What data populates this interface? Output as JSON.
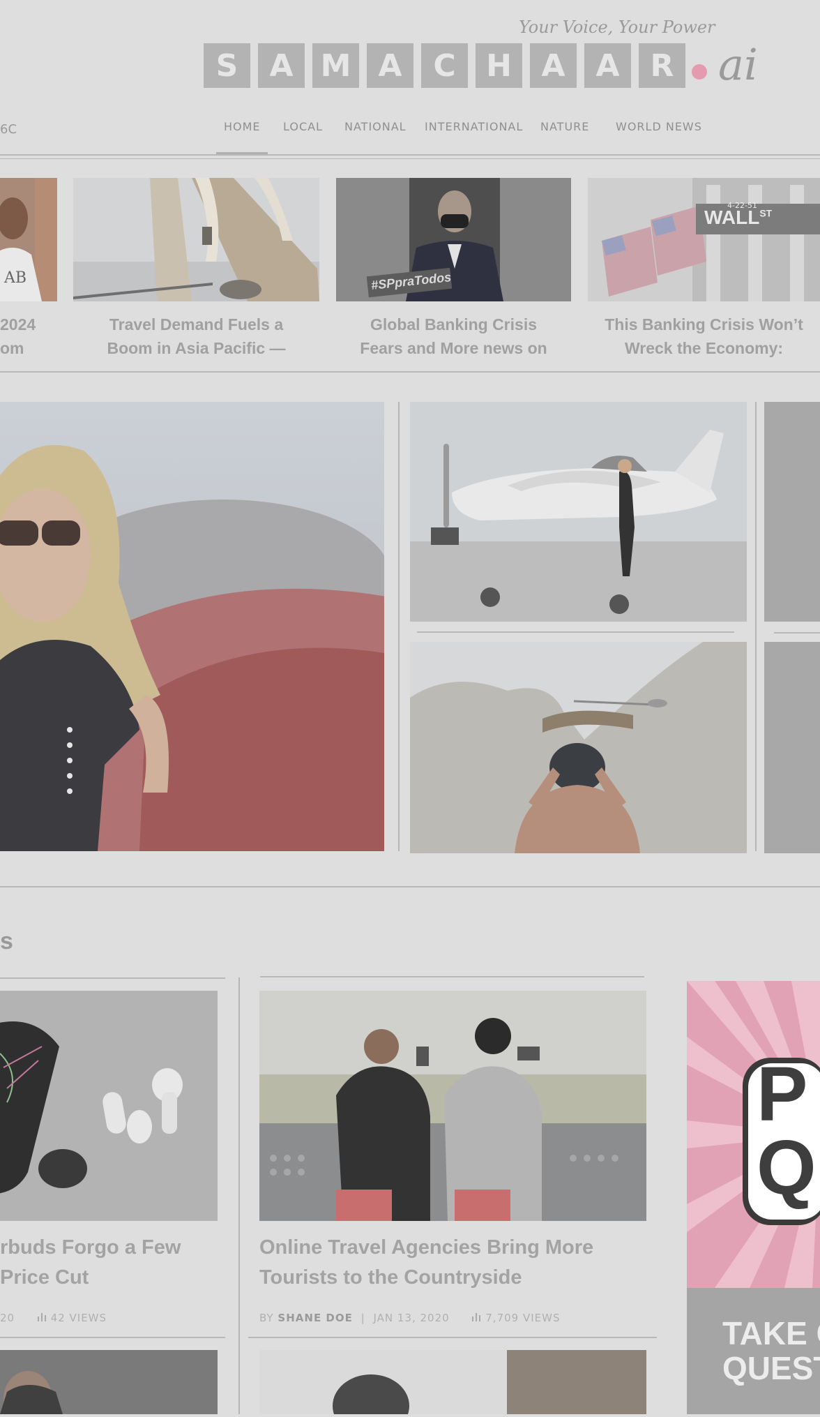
{
  "brand": {
    "tagline": "Your Voice, Your Power",
    "letters": [
      "S",
      "A",
      "M",
      "A",
      "C",
      "H",
      "A",
      "A",
      "R"
    ],
    "suffix": "ai",
    "dot_color": "#e59ab0"
  },
  "weather": "6C",
  "nav": {
    "items": [
      "HOME",
      "LOCAL",
      "NATIONAL",
      "INTERNATIONAL",
      "NATURE",
      "WORLD NEWS"
    ],
    "active": "HOME"
  },
  "ticker": [
    {
      "line1": "2024",
      "line2": "om",
      "image": "portrait-man-white-shirt"
    },
    {
      "line1": "Travel Demand Fuels a",
      "line2": "Boom in Asia Pacific —",
      "image": "seaside-terrace"
    },
    {
      "line1": "Global Banking Crisis",
      "line2": "Fears and More news on",
      "image": "man-in-mask-suit"
    },
    {
      "line1": "This Banking Crisis Won’t",
      "line2": "Wreck the Economy:",
      "image": "wall-street-flags"
    }
  ],
  "ticker_images": {
    "hashtag": "#SPpraTodos",
    "street_sign": "WALL",
    "street_sign_suffix": "ST",
    "address": "4-22-51"
  },
  "featured": {
    "main_image": "woman-sunglasses-red-car",
    "side_images": [
      "white-airplane-woman",
      "outdoor-shower-stone-wall"
    ]
  },
  "section": {
    "heading_fragment": "s"
  },
  "cards": [
    {
      "title_line1": "rbuds Forgo a Few",
      "title_line2": "Price Cut",
      "date_fragment": "20",
      "views": "42 VIEWS",
      "image": "phone-and-earbuds"
    },
    {
      "title_line1": "Online Travel Agencies Bring More",
      "title_line2": "Tourists to the Countryside",
      "by": "BY",
      "author": "SHANE DOE",
      "date": "JAN 13, 2020",
      "views": "7,709 VIEWS",
      "image": "two-people-photographing"
    }
  ],
  "ad": {
    "big_line1": "P",
    "big_line2": "Q",
    "cta_line1": "TAKE C",
    "cta_line2": "QUEST"
  },
  "colors": {
    "background": "#dedede",
    "logo_box": "#b3b3b3",
    "ad_pink": "#e2a2b6"
  }
}
